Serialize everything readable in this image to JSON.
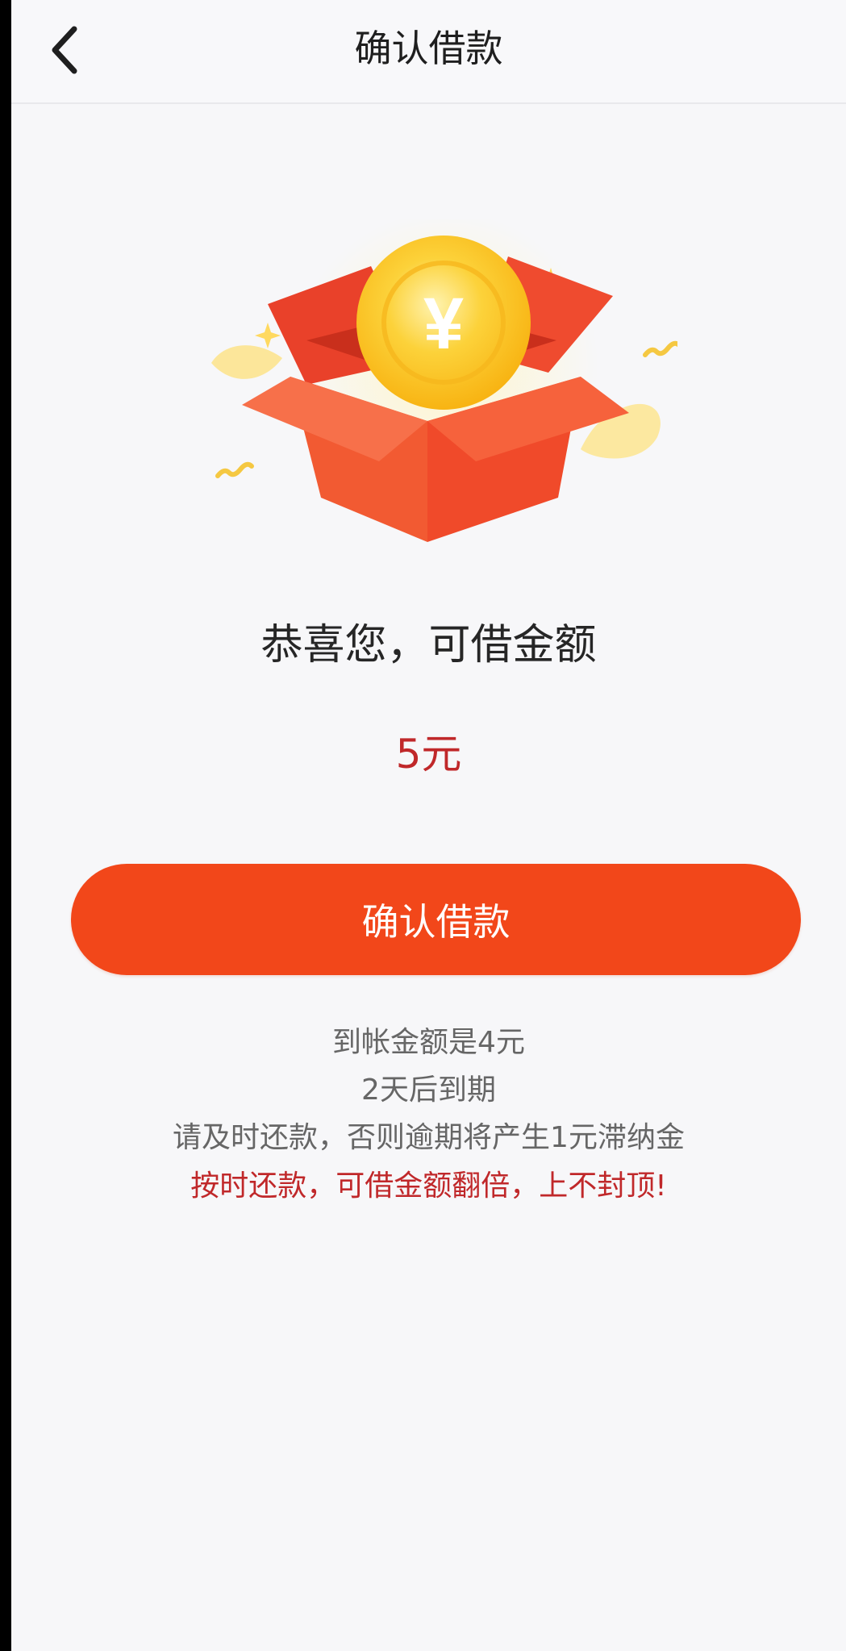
{
  "navbar": {
    "title": "确认借款",
    "back_icon": "chevron-left-icon"
  },
  "hero": {
    "illustration": "gift-box-with-coin-icon",
    "coin_symbol": "¥",
    "colors": {
      "box": "#f2542e",
      "coin": "#fcc21c",
      "accent": "#fde38a"
    }
  },
  "main": {
    "headline": "恭喜您，可借金额",
    "amount": "5元",
    "confirm_button": "确认借款"
  },
  "info": {
    "line1": "到帐金额是4元",
    "line2": "2天后到期",
    "line3": "请及时还款，否则逾期将产生1元滞纳金",
    "line4": "按时还款，可借金额翻倍，上不封顶!"
  },
  "colors": {
    "primary": "#f2471a",
    "highlight_text": "#c0282a",
    "secondary_text": "#666666"
  }
}
